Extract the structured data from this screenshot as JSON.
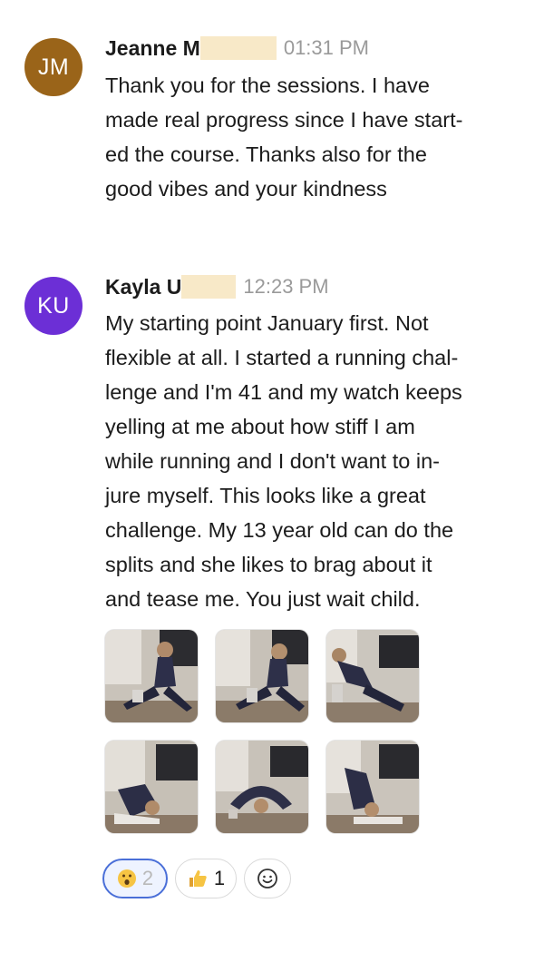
{
  "messages": [
    {
      "initials": "JM",
      "avatar_color": "#9a6419",
      "name": "Jeanne M",
      "time": "01:31 PM",
      "lines": [
        "Thank you for the sessions. I have",
        "made real progress since I have start-",
        "ed the course. Thanks also for the",
        "good vibes and your kindness"
      ]
    },
    {
      "initials": "KU",
      "avatar_color": "#6c2fd6",
      "name": "Kayla U",
      "time": "12:23 PM",
      "lines": [
        "My starting point January first.  Not",
        "flexible at all. I started a running chal-",
        "lenge and I'm 41 and my watch keeps",
        "yelling at me about how stiff I am",
        "while running and I don't want to in-",
        "jure myself. This looks like a great",
        "challenge.  My 13 year old can do the",
        "splits and she likes to brag about it",
        "and tease me. You just wait child."
      ],
      "attachments": [
        {
          "icon": "photo-splits-stretch"
        },
        {
          "icon": "photo-splits-stretch"
        },
        {
          "icon": "photo-side-lunge"
        },
        {
          "icon": "photo-forward-fold"
        },
        {
          "icon": "photo-backbend"
        },
        {
          "icon": "photo-forward-fold"
        }
      ],
      "reactions": [
        {
          "emoji": "surprised-face-icon",
          "count": "2",
          "active": true
        },
        {
          "emoji": "thumbs-up-icon",
          "count": "1",
          "active": false
        }
      ],
      "add_reaction_icon": "smiley-add-icon"
    }
  ],
  "colors": {
    "accent": "#4a6fd8",
    "timestamp": "#9a9a9a",
    "redaction": "#f8e9c8"
  }
}
